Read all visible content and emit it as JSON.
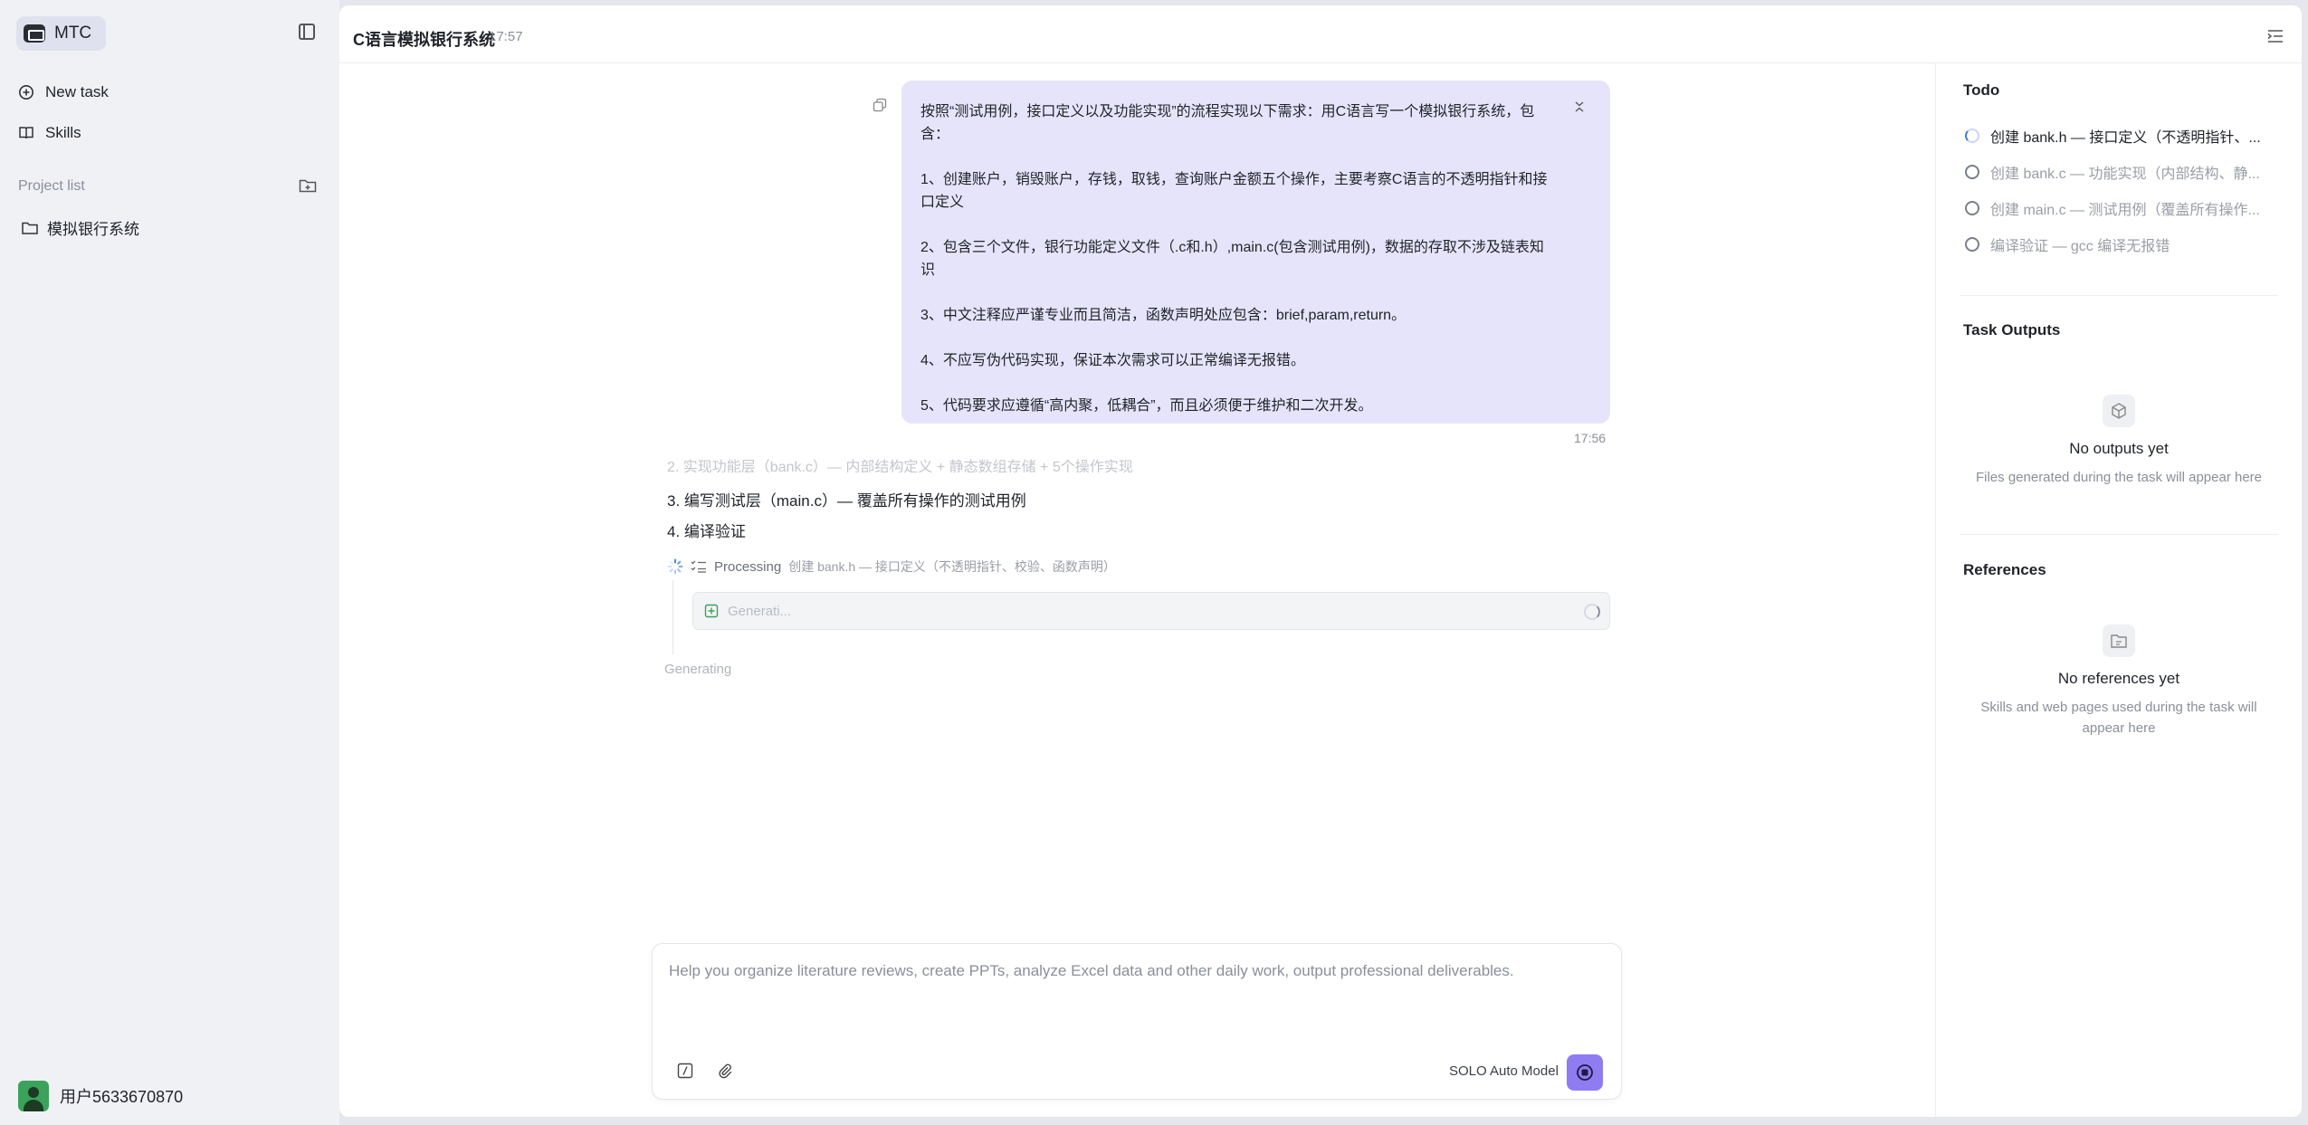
{
  "sidebar": {
    "brand": "MTC",
    "nav": [
      {
        "label": "New task",
        "icon": "plus-circle-icon"
      },
      {
        "label": "Skills",
        "icon": "book-icon"
      }
    ],
    "project_list_label": "Project list",
    "projects": [
      {
        "label": "模拟银行系统",
        "icon": "folder-icon"
      }
    ],
    "user": "用户5633670870"
  },
  "header": {
    "title": "C语言模拟银行系统",
    "time": "17:57"
  },
  "chat": {
    "user_message": [
      "按照“测试用例，接口定义以及功能实现”的流程实现以下需求：用C语言写一个模拟银行系统，包含：",
      "1、创建账户，销毁账户，存钱，取钱，查询账户金额五个操作，主要考察C语言的不透明指针和接口定义",
      "2、包含三个文件，银行功能定义文件（.c和.h）,main.c(包含测试用例)，数据的存取不涉及链表知识",
      "3、中文注释应严谨专业而且简洁，函数声明处应包含：brief,param,return。",
      "4、不应写伪代码实现，保证本次需求可以正常编译无报错。",
      "5、代码要求应遵循“高内聚，低耦合”，而且必须便于维护和二次开发。"
    ],
    "message_time": "17:56",
    "faded_step": "2. 实现功能层（bank.c）— 内部结构定义 + 静态数组存储 + 5个操作实现",
    "steps": [
      "3. 编写测试层（main.c）— 覆盖所有操作的测试用例",
      "4. 编译验证"
    ],
    "processing_label": "Processing",
    "processing_detail": "创建 bank.h — 接口定义（不透明指针、校验、函数声明）",
    "generating_box": "Generati...",
    "generating_status": "Generating"
  },
  "composer": {
    "placeholder": "Help you organize literature reviews, create PPTs, analyze Excel data and other daily work, output professional deliverables.",
    "model": "SOLO Auto Model"
  },
  "right_panel": {
    "todo_title": "Todo",
    "todos": [
      {
        "label": "创建 bank.h — 接口定义（不透明指针、...",
        "status": "in-progress"
      },
      {
        "label": "创建 bank.c — 功能实现（内部结构、静...",
        "status": "pending"
      },
      {
        "label": "创建 main.c — 测试用例（覆盖所有操作...",
        "status": "pending"
      },
      {
        "label": "编译验证 — gcc 编译无报错",
        "status": "pending"
      }
    ],
    "outputs_title": "Task Outputs",
    "outputs_empty_title": "No outputs yet",
    "outputs_empty_sub": "Files generated during the task will appear here",
    "refs_title": "References",
    "refs_empty_title": "No references yet",
    "refs_empty_sub": "Skills and web pages used during the task will appear here"
  },
  "colors": {
    "accent": "#8f7cf2",
    "user_bubble": "#e6e4fb",
    "sidebar_bg": "#f0f1f5",
    "progress_blue": "#3d7bd8"
  }
}
